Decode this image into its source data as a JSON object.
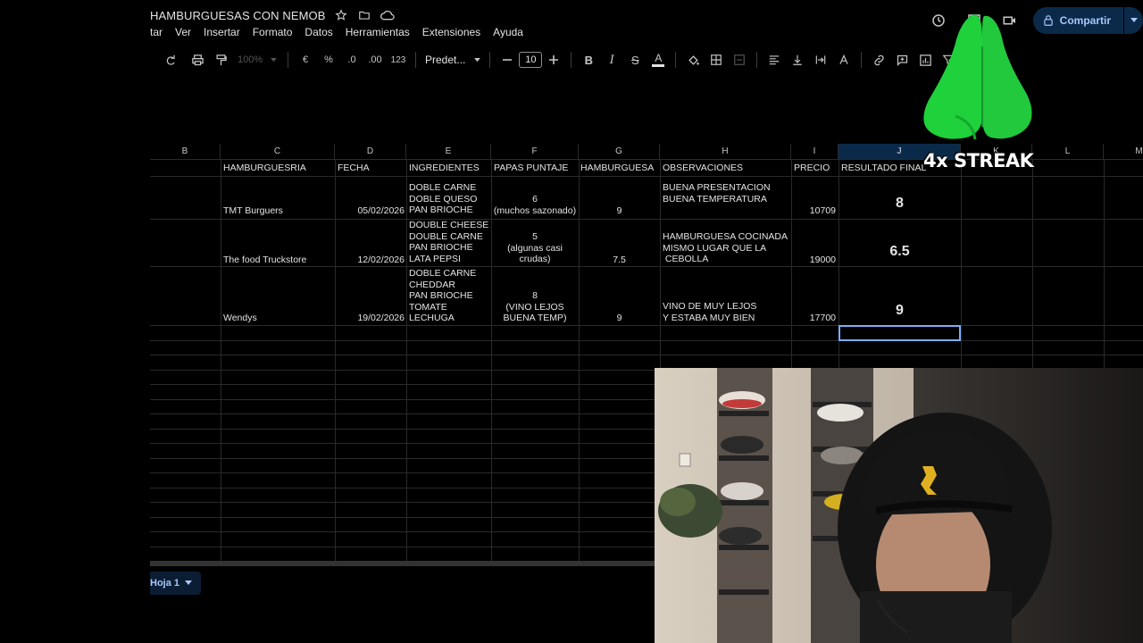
{
  "title": {
    "doc_title": "HAMBURGUESAS CON NEMOB",
    "menus": [
      "tar",
      "Ver",
      "Insertar",
      "Formato",
      "Datos",
      "Herramientas",
      "Extensiones",
      "Ayuda"
    ],
    "share_label": "Compartir"
  },
  "toolbar": {
    "zoom": "100%",
    "currency": "€",
    "percent": "%",
    "dec_minus": ".0",
    "dec_plus": ".00",
    "format_123": "123",
    "font": "Predet...",
    "font_size": "10"
  },
  "columns": [
    "B",
    "C",
    "D",
    "E",
    "F",
    "G",
    "H",
    "I",
    "J",
    "K",
    "L",
    "M"
  ],
  "headers": {
    "c": "HAMBURGUESRIA",
    "d": "FECHA",
    "e": "INGREDIENTES",
    "f": "PAPAS PUNTAJE",
    "g": "HAMBURGUESA",
    "h": "OBSERVACIONES",
    "i": "PRECIO",
    "j": "RESULTADO FINAL"
  },
  "rows": [
    {
      "name": "TMT Burguers",
      "fecha": "05/02/2026",
      "ingredientes": "DOBLE CARNE\nDOBLE QUESO\nPAN BRIOCHE",
      "papas": "6\n(muchos sazonado)",
      "hamburguesa": "9",
      "observaciones": "BUENA PRESENTACION\nBUENA TEMPERATURA",
      "precio": "10709",
      "resultado": "8"
    },
    {
      "name": "The food Truckstore",
      "fecha": "12/02/2026",
      "ingredientes": "DOUBLE CHEESE\nDOUBLE CARNE\nPAN BRIOCHE\nLATA PEPSI",
      "papas": "5\n(algunas casi\ncrudas)",
      "hamburguesa": "7.5",
      "observaciones": "HAMBURGUESA COCINADA\nMISMO LUGAR QUE LA\n CEBOLLA",
      "precio": "19000",
      "resultado": "6.5"
    },
    {
      "name": "Wendys",
      "fecha": "19/02/2026",
      "ingredientes": "DOBLE CARNE\nCHEDDAR\nPAN BRIOCHE\nTOMATE\nLECHUGA",
      "papas": "8\n(VINO LEJOS\nBUENA TEMP)",
      "hamburguesa": "9",
      "observaciones": "VINO DE MUY LEJOS\nY ESTABA MUY BIEN",
      "precio": "17700",
      "resultado": "9"
    }
  ],
  "sheet_tab": "Hoja 1",
  "overlay": {
    "streak": "4x STREAK"
  },
  "colors": {
    "accent": "#a8c7fa",
    "share_bg": "#0b2a4a",
    "selection": "#7cacf8",
    "sticker_green": "#1fd13a"
  }
}
